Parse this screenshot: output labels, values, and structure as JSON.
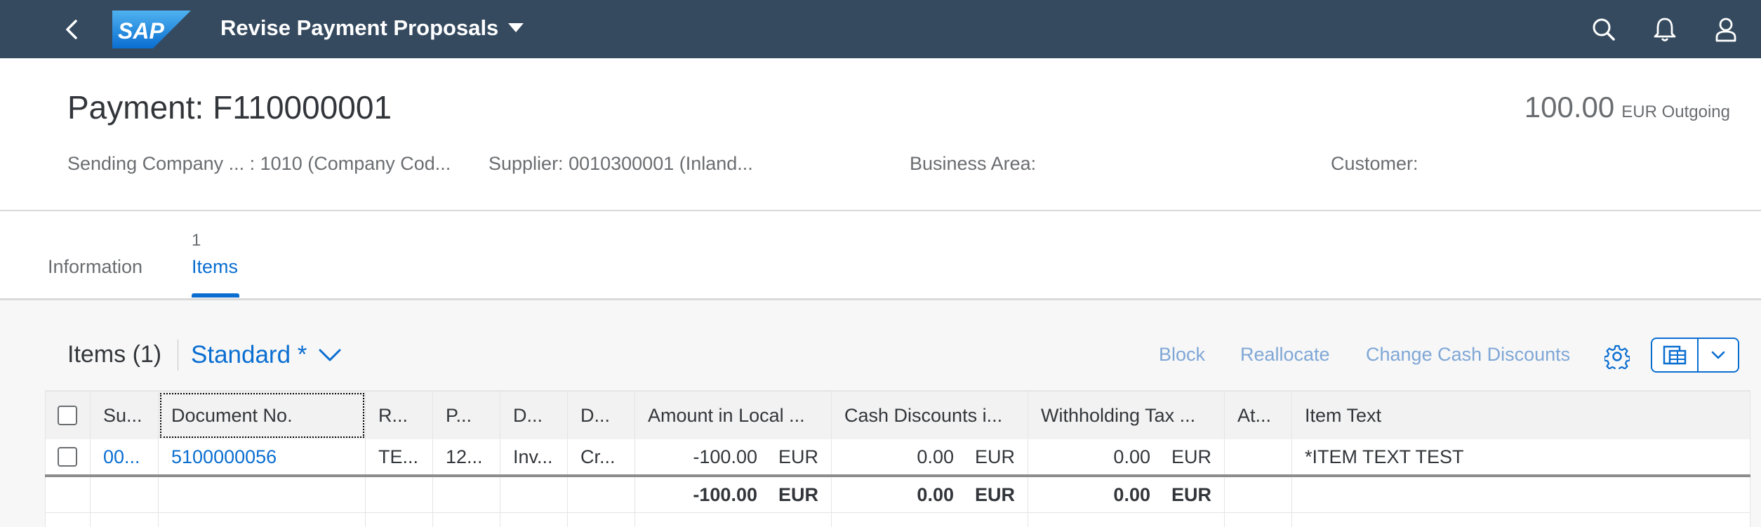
{
  "shell": {
    "app_title": "Revise Payment Proposals",
    "logo_text": "SAP",
    "icons": [
      "back-icon",
      "search-icon",
      "bell-icon",
      "user-icon"
    ]
  },
  "header": {
    "title": "Payment: F110000001",
    "amount": "100.00",
    "amount_suffix": "EUR Outgoing",
    "attributes": [
      "Sending Company ... : 1010 (Company Cod...",
      "Supplier: 0010300001 (Inland...",
      "Business Area:",
      "Customer:"
    ]
  },
  "tabs": [
    {
      "label": "Information",
      "count": ""
    },
    {
      "label": "Items",
      "count": "1",
      "selected": true
    }
  ],
  "toolbar": {
    "title": "Items (1)",
    "variant": "Standard *",
    "buttons": [
      "Block",
      "Reallocate",
      "Change Cash Discounts"
    ],
    "icons": [
      "settings-icon",
      "export-icon",
      "chevron-down-icon"
    ]
  },
  "table": {
    "columns": [
      "Su...",
      "Document No.",
      "R...",
      "P...",
      "D...",
      "D...",
      "Amount in Local ...",
      "Cash Discounts i...",
      "Withholding Tax ...",
      "At...",
      "Item Text"
    ],
    "rows": [
      [
        "00...",
        "5100000056",
        "TE...",
        "12...",
        "Inv...",
        "Cr...",
        "-100.00",
        "EUR",
        "0.00",
        "EUR",
        "0.00",
        "EUR",
        "",
        "*ITEM TEXT TEST"
      ]
    ],
    "totals": [
      "-100.00",
      "EUR",
      "0.00",
      "EUR",
      "0.00",
      "EUR"
    ]
  },
  "colors": {
    "shell_bg": "#354a5f",
    "accent": "#0a6ed1",
    "page_bg": "#f7f7f7"
  }
}
